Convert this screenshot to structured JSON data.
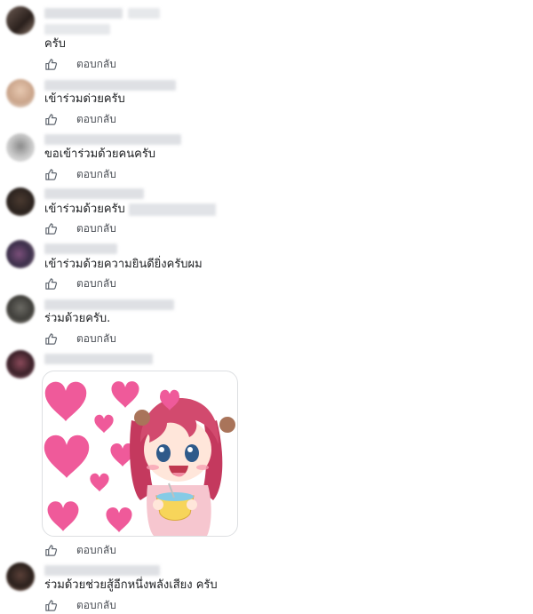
{
  "comments": [
    {
      "text": "ครับ",
      "reply_label": "ตอบกลับ"
    },
    {
      "text": "เข้าร่วมด่วยครับ",
      "reply_label": "ตอบกลับ"
    },
    {
      "text": "ขอเข้าร่วมด้วยคนครับ",
      "reply_label": "ตอบกลับ"
    },
    {
      "text": "เข้าร่วมด้วยครับ",
      "reply_label": "ตอบกลับ"
    },
    {
      "text": "เข้าร่วมด้วยความยินดียิ่งครับผม",
      "reply_label": "ตอบกลับ"
    },
    {
      "text": "ร่วมด้วยครับ.",
      "reply_label": "ตอบกลับ"
    },
    {
      "text": "",
      "reply_label": "ตอบกลับ"
    },
    {
      "text": "ร่วมด้วยช่วยสู้อีกหนึ่งพลังเสียง ครับ",
      "reply_label": "ตอบกลับ"
    }
  ],
  "sticker": {
    "icon": "anime-girl-hearts-sticker"
  },
  "colors": {
    "reply_text": "#4b4f56",
    "heart": "#ef5a9a",
    "hair": "#c4395e"
  }
}
